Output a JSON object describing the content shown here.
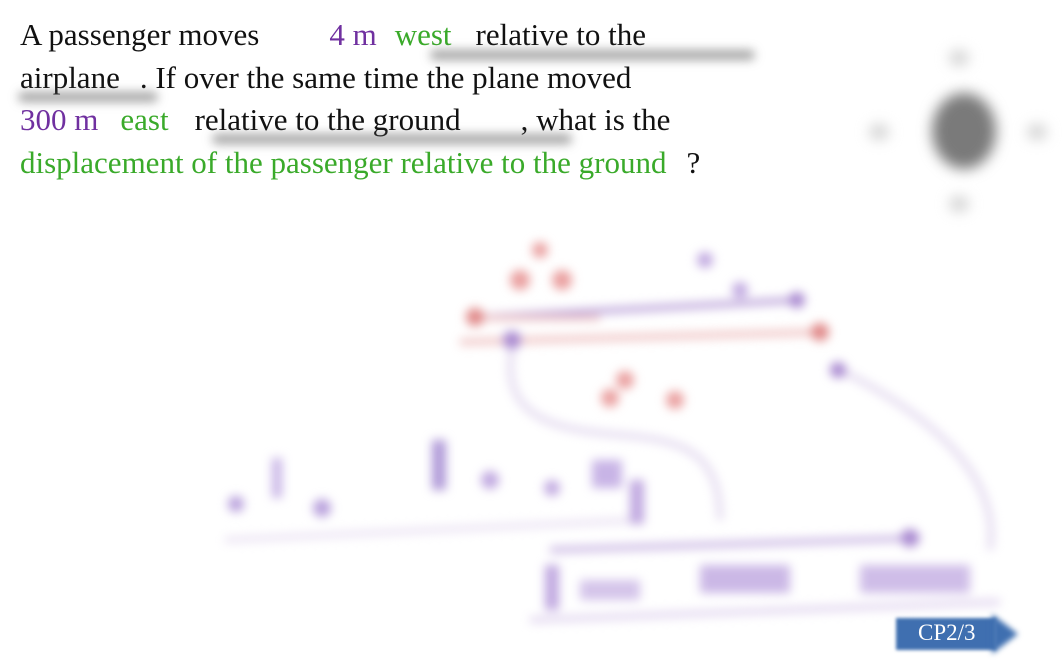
{
  "slide": {
    "question": {
      "p1": "A passenger moves",
      "distance_1": "4 m",
      "direction_1": "west",
      "p2": "relative to the",
      "p3": "airplane",
      "p4": ". If over the same time the plane moved",
      "distance_2": "300 m",
      "direction_2": "east",
      "p5": "relative to the ground",
      "p6": ", what is the",
      "target": "displacement of the passenger relative to the ground",
      "end": "?"
    },
    "colors": {
      "quantity": "#7030a0",
      "keyword": "#3aaa2a",
      "badge": "#3f6fb0"
    },
    "badge": {
      "label": "CP2/3"
    }
  }
}
